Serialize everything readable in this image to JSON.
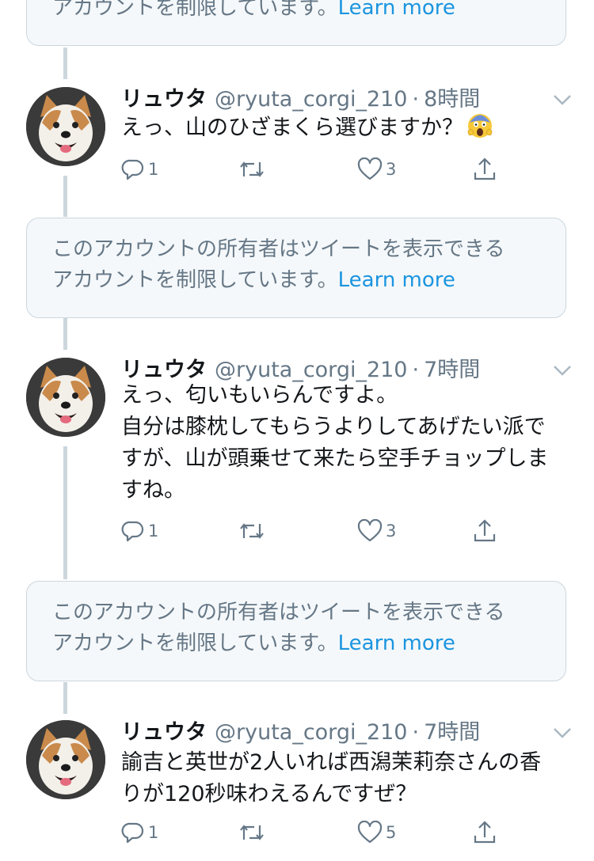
{
  "notices": [
    {
      "text": "アカウントを制限しています。",
      "link": "Learn more"
    },
    {
      "line1": "このアカウントの所有者はツイートを表示できる",
      "line2": "アカウントを制限しています。",
      "link": "Learn more"
    },
    {
      "line1": "このアカウントの所有者はツイートを表示できる",
      "line2": "アカウントを制限しています。",
      "link": "Learn more"
    }
  ],
  "tweets": [
    {
      "name": "リュウタ",
      "handle": "@ryuta_corgi_210",
      "time": "8時間",
      "sep": "·",
      "text": "えっ、山のひざまくら選びますか？",
      "emoji": "face-screaming-in-fear",
      "replies": "1",
      "likes": "3"
    },
    {
      "name": "リュウタ",
      "handle": "@ryuta_corgi_210",
      "time": "7時間",
      "sep": "·",
      "text": "えっ、匂いもいらんですよ。\n自分は膝枕してもらうよりしてあげたい派で\nすが、山が頭乗せて来たら空手チョップしま\nすね。",
      "replies": "1",
      "likes": "3"
    },
    {
      "name": "リュウタ",
      "handle": "@ryuta_corgi_210",
      "time": "7時間",
      "sep": "·",
      "text": "諭吉と英世が2人いれば西潟茉莉奈さんの香\nりが120秒味わえるんですぜ？",
      "replies": "1",
      "likes": "5"
    }
  ],
  "colors": {
    "accent": "#1b95e0",
    "muted": "#657786",
    "border": "#ccd6dd",
    "notice_bg": "#f5f8fa"
  }
}
